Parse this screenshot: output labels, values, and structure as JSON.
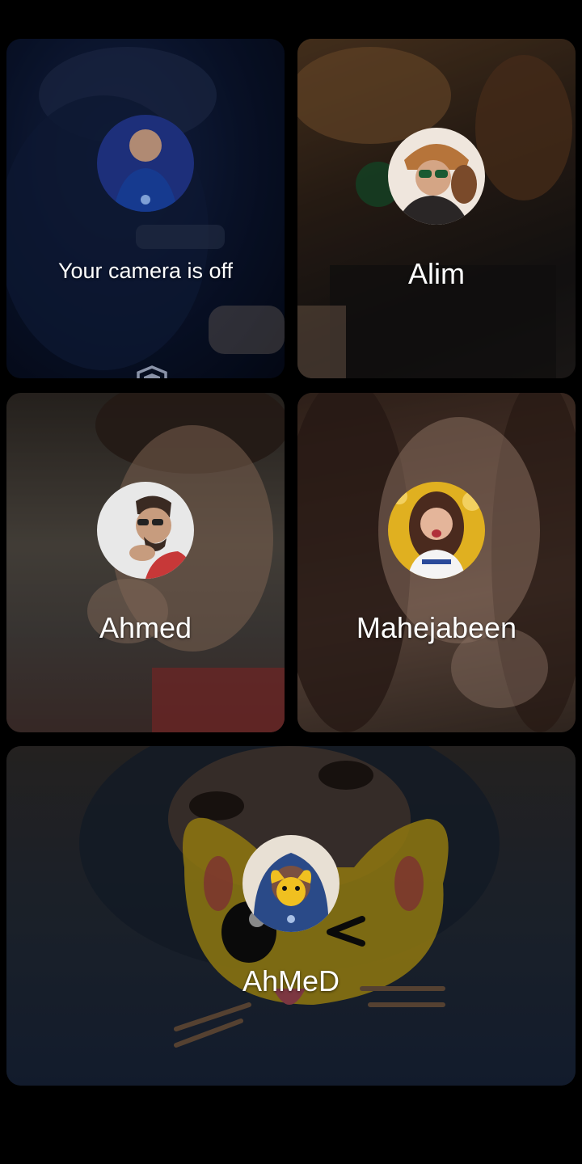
{
  "participants": [
    {
      "label": "Your camera is off",
      "is_self": true,
      "privacy_icon": "shield-icon"
    },
    {
      "label": "Alim"
    },
    {
      "label": "Ahmed"
    },
    {
      "label": "Mahejabeen"
    },
    {
      "label": "AhMeD",
      "effect": "cat-face-filter"
    }
  ],
  "colors": {
    "background": "#000000",
    "label_text": "#ffffff"
  }
}
